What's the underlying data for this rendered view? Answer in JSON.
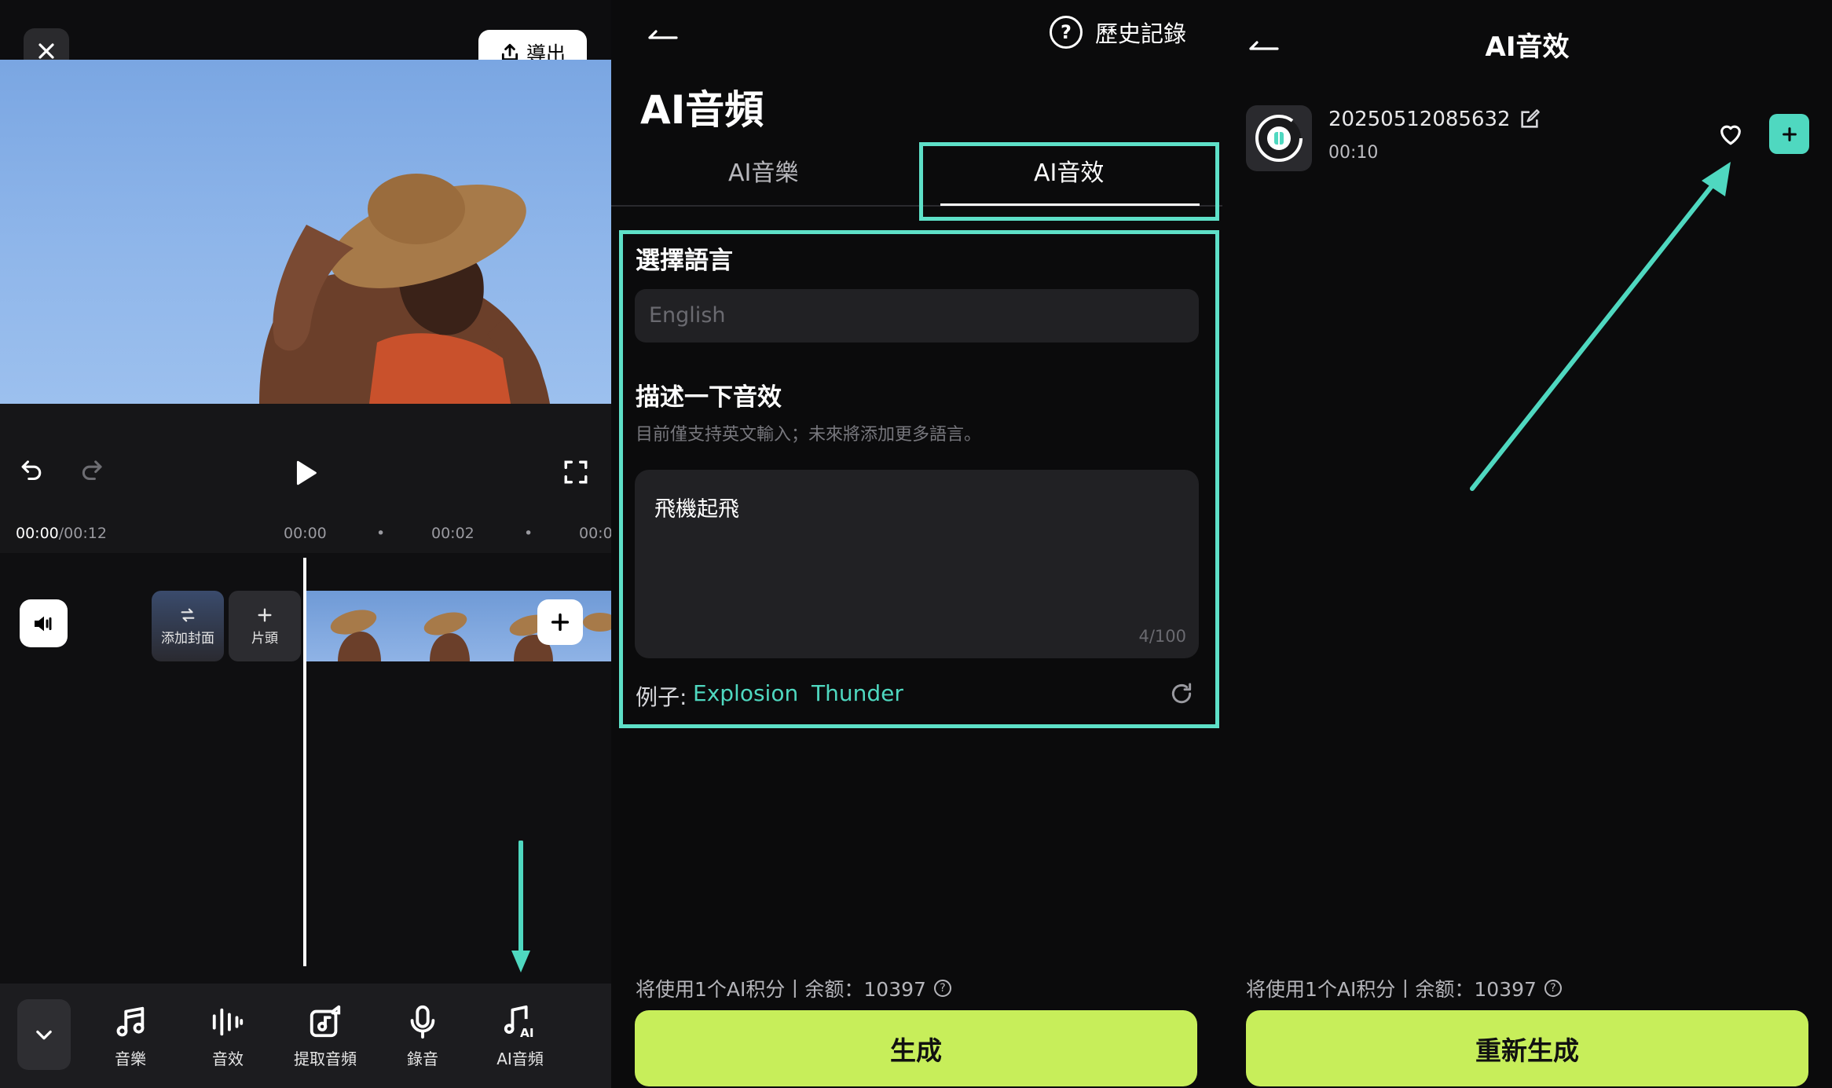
{
  "editor": {
    "export_label": "導出",
    "time_current": "00:00",
    "time_total": "/00:12",
    "ruler_ticks": [
      "00:00",
      "•",
      "00:02",
      "•",
      "00:0"
    ],
    "cover_label": "添加封面",
    "intro_label": "片頭",
    "tools": [
      {
        "label": "音樂",
        "icon": "music-note-icon"
      },
      {
        "label": "音效",
        "icon": "sound-wave-icon"
      },
      {
        "label": "提取音頻",
        "icon": "extract-audio-icon"
      },
      {
        "label": "錄音",
        "icon": "microphone-icon"
      },
      {
        "label": "AI音頻",
        "icon": "ai-audio-icon"
      }
    ]
  },
  "ai_audio": {
    "history_label": "歷史記錄",
    "title": "AI音頻",
    "tabs": [
      "AI音樂",
      "AI音效"
    ],
    "active_tab": "AI音效",
    "language_label": "選擇語言",
    "language_placeholder": "English",
    "describe_label": "描述一下音效",
    "hint": "目前僅支持英文輸入；未來將添加更多語言。",
    "prompt_value": "飛機起飛",
    "char_count": "4/100",
    "examples_label": "例子:",
    "examples": [
      "Explosion",
      "Thunder"
    ],
    "credits_text": "将使用1个AI积分丨余额：10397",
    "generate_label": "生成"
  },
  "result": {
    "title": "AI音效",
    "item_name": "20250512085632",
    "item_duration": "00:10",
    "credits_text": "将使用1个AI积分丨余额：10397",
    "regenerate_label": "重新生成"
  },
  "colors": {
    "accent_teal": "#4fd8c0",
    "highlight_box": "#5ee0c8",
    "cta_green": "#c7ee5a",
    "background": "#0b0b0c"
  }
}
